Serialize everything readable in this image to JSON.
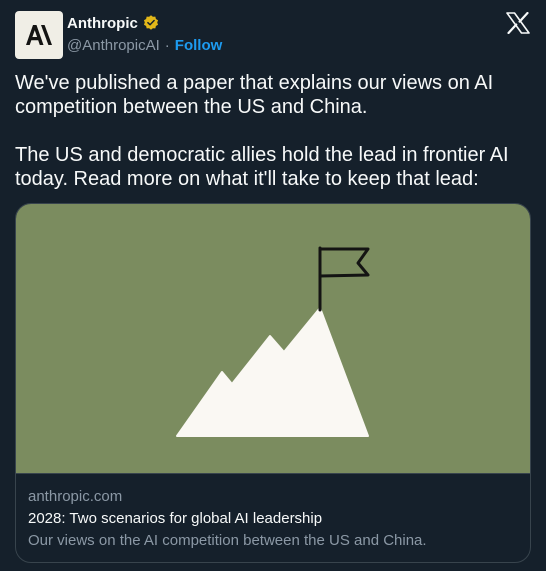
{
  "author": {
    "name": "Anthropic",
    "handle": "@AnthropicAI",
    "separator": "·",
    "follow_label": "Follow",
    "avatar_icon": "anthropic-logo",
    "verified_color": "#e2b719"
  },
  "platform_icon": "x-logo-icon",
  "tweet": {
    "paragraphs": [
      "We've published a paper that explains our views on AI competition between the US and China.",
      "The US and democratic allies hold the lead in frontier AI today. Read more on what it'll take to keep that lead:"
    ]
  },
  "link_card": {
    "image": "mountain-with-flag-illustration",
    "image_background": "#7b8c5f",
    "domain": "anthropic.com",
    "title": "2028: Two scenarios for global AI leadership",
    "description": "Our views on the AI competition between the US and China."
  },
  "colors": {
    "background": "#15202b",
    "text": "#f7f9f9",
    "muted": "#8b98a5",
    "accent": "#1d9bf0",
    "border": "#38444d"
  }
}
